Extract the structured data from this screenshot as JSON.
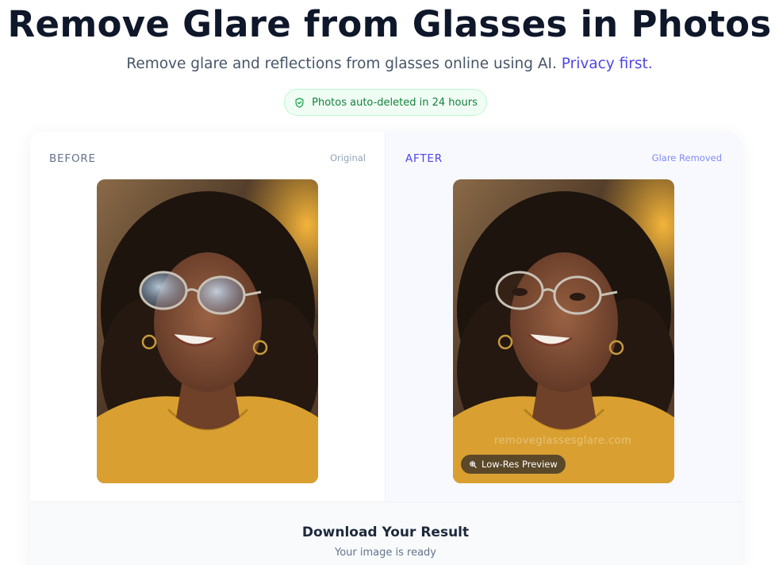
{
  "header": {
    "title": "Remove Glare from Glasses in Photos",
    "subtitle": "Remove glare and reflections from glasses online using AI.",
    "subtitle_link": "Privacy first."
  },
  "badge": {
    "icon": "shield-check-icon",
    "label": "Photos auto-deleted in 24 hours"
  },
  "comparison": {
    "before": {
      "label": "BEFORE",
      "tag": "Original"
    },
    "after": {
      "label": "AFTER",
      "tag": "Glare Removed",
      "watermark": "removeglassesglare.com",
      "preview_label": "Low-Res Preview",
      "preview_icon": "zoom-icon"
    }
  },
  "result": {
    "title": "Download Your Result",
    "subtitle": "Your image is ready"
  },
  "colors": {
    "accent": "#4f46e5",
    "success": "#15803d",
    "text": "#0f172a"
  }
}
